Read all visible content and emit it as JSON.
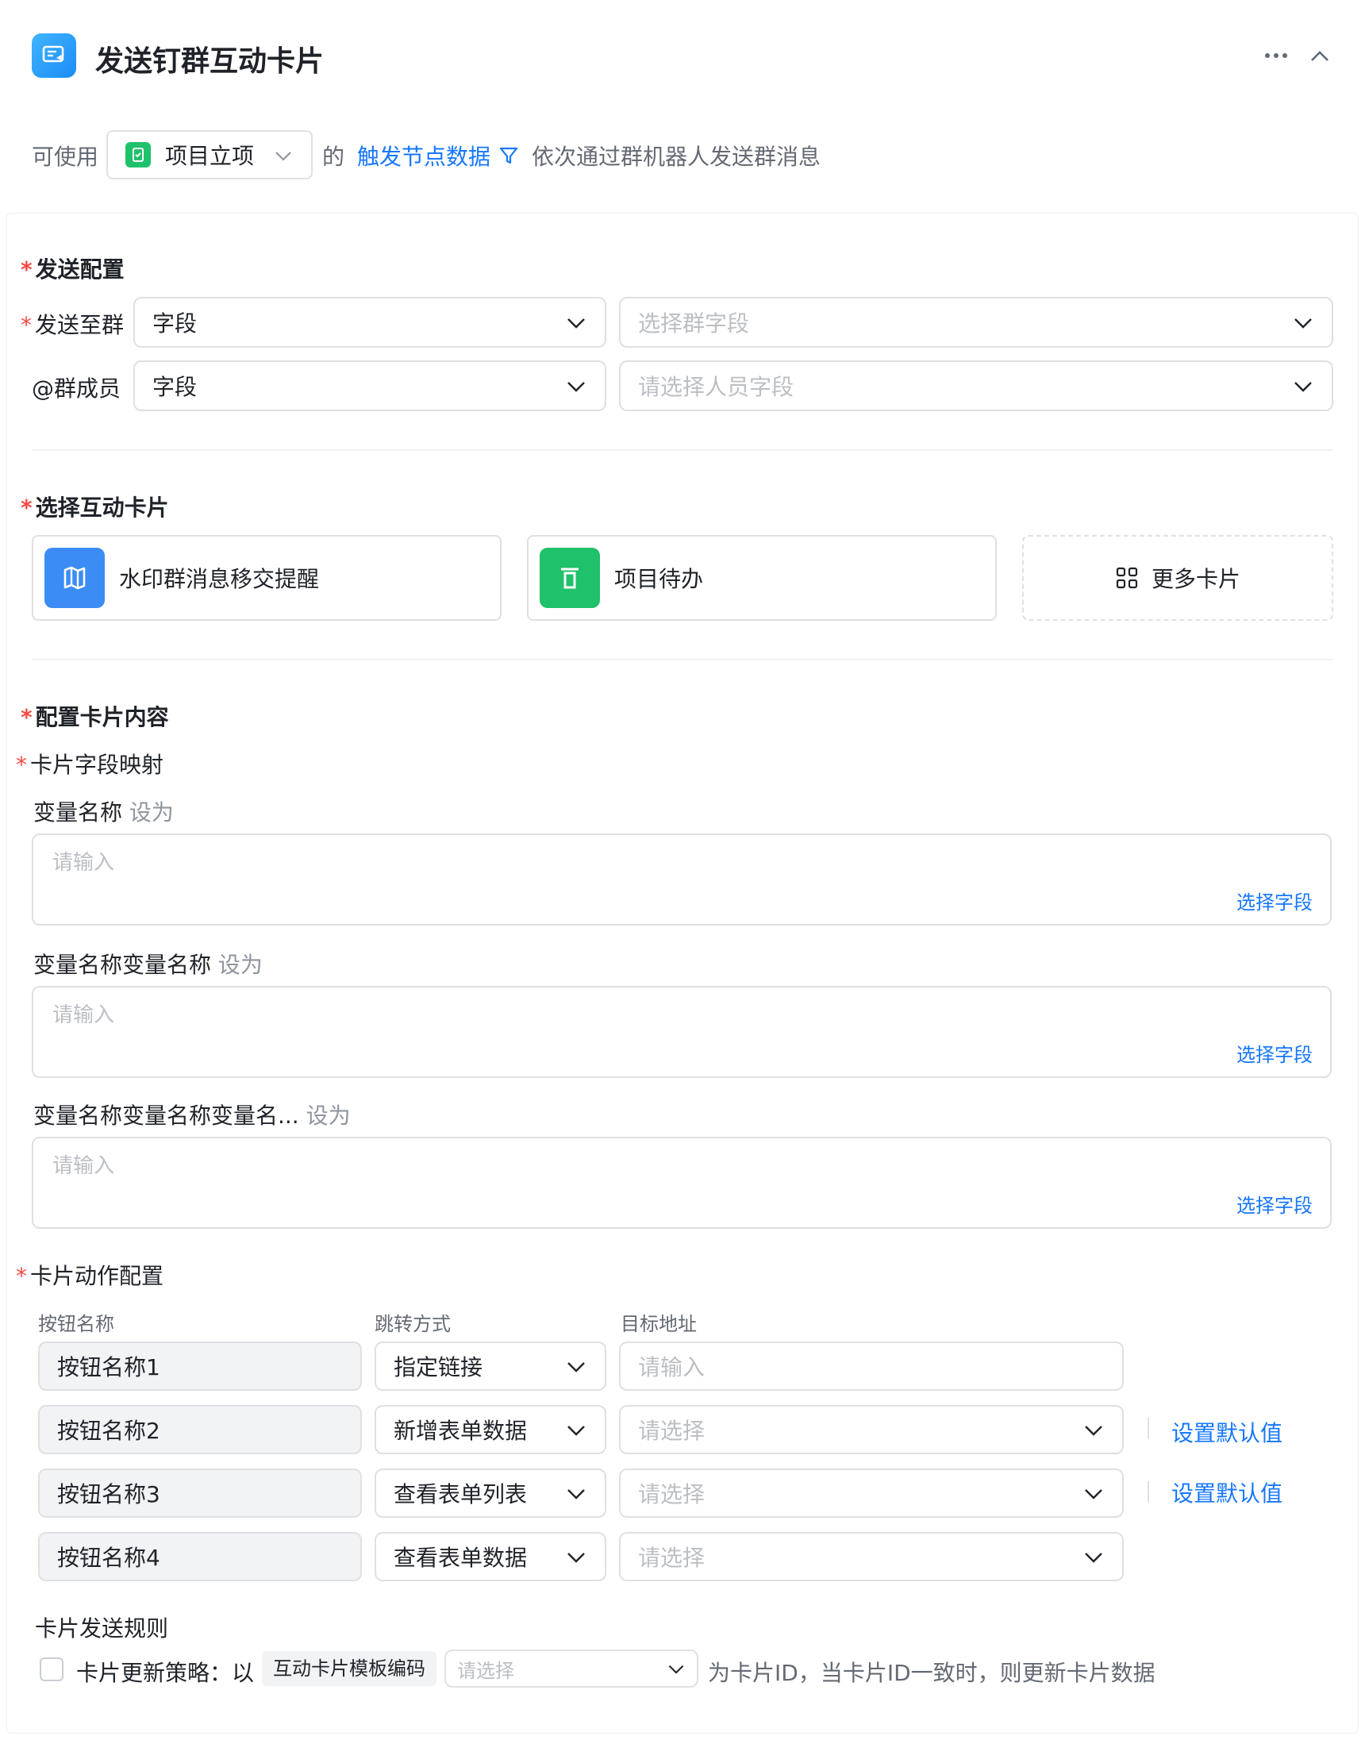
{
  "header": {
    "title": "发送钉群互动卡片",
    "more_icon": "more-horizontal-icon",
    "collapse_icon": "chevron-up-icon"
  },
  "summary": {
    "prefix": "可使用",
    "form_name": "项目立项",
    "of": "的",
    "source": "触发节点数据",
    "suffix": "依次通过群机器人发送群消息"
  },
  "send_config": {
    "section_title": "发送配置",
    "rows": [
      {
        "label": "发送至群",
        "required": true,
        "type_value": "字段",
        "target_placeholder": "选择群字段"
      },
      {
        "label": "@群成员",
        "required": false,
        "type_value": "字段",
        "target_placeholder": "请选择人员字段"
      }
    ]
  },
  "card_select": {
    "section_title": "选择互动卡片",
    "cards": [
      {
        "label": "水印群消息移交提醒",
        "color": "#3c8cf5",
        "icon": "map-icon"
      },
      {
        "label": "项目待办",
        "color": "#1fc16a",
        "icon": "todo-icon"
      }
    ],
    "more_label": "更多卡片"
  },
  "card_content": {
    "section_title": "配置卡片内容",
    "mapping_title": "卡片字段映射",
    "fields": [
      {
        "name": "变量名称",
        "set_as": "设为",
        "placeholder": "请输入",
        "pick_label": "选择字段"
      },
      {
        "name": "变量名称变量名称",
        "set_as": "设为",
        "placeholder": "请输入",
        "pick_label": "选择字段"
      },
      {
        "name": "变量名称变量名称变量名...",
        "set_as": "设为",
        "placeholder": "请输入",
        "pick_label": "选择字段"
      }
    ]
  },
  "actions": {
    "section_title": "卡片动作配置",
    "columns": [
      "按钮名称",
      "跳转方式",
      "目标地址"
    ],
    "rows": [
      {
        "button": "按钮名称1",
        "mode": "指定链接",
        "target_placeholder": "请输入",
        "default_label": ""
      },
      {
        "button": "按钮名称2",
        "mode": "新增表单数据",
        "target_placeholder": "请选择",
        "default_label": "设置默认值"
      },
      {
        "button": "按钮名称3",
        "mode": "查看表单列表",
        "target_placeholder": "请选择",
        "default_label": "设置默认值"
      },
      {
        "button": "按钮名称4",
        "mode": "查看表单数据",
        "target_placeholder": "请选择",
        "default_label": ""
      }
    ]
  },
  "send_rule": {
    "title": "卡片发送规则",
    "strategy_label": "卡片更新策略：以",
    "tag": "互动卡片模板编码",
    "select_placeholder": "请选择",
    "suffix": "为卡片ID，当卡片ID一致时，则更新卡片数据"
  },
  "colors": {
    "primary": "#1677ff",
    "required": "#f54a45",
    "border": "#dee0e3"
  }
}
